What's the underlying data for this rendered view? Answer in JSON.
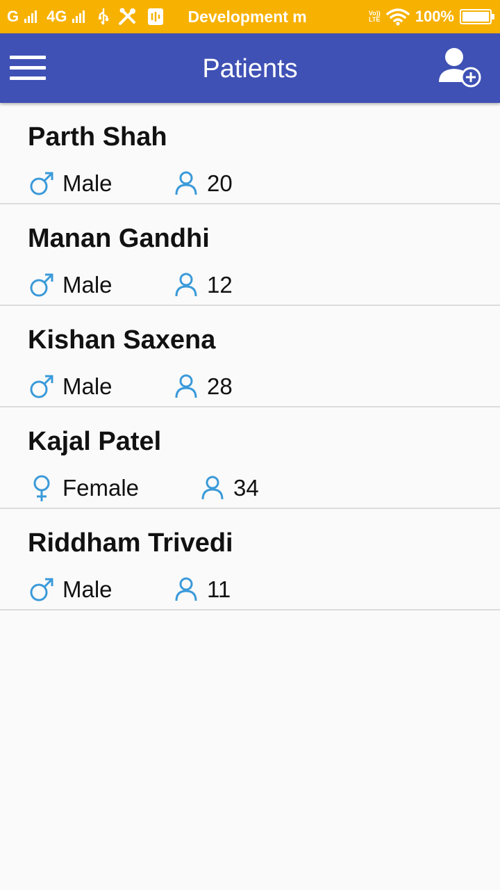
{
  "status_bar": {
    "carrier_1": "G",
    "carrier_2": "4G",
    "notification_text": "Development m",
    "volte_top": "Vo))",
    "volte_bottom": "LTE",
    "battery": "100%",
    "battery_level": 1.0
  },
  "app_bar": {
    "title": "Patients",
    "menu_icon": "hamburger-menu-icon",
    "add_icon": "add-user-icon"
  },
  "colors": {
    "status_bar": "#f7b100",
    "app_bar": "#3f51b5",
    "icon_accent": "#3a9ad9"
  },
  "patients": [
    {
      "name": "Parth Shah",
      "gender": "Male",
      "age": "20"
    },
    {
      "name": "Manan Gandhi",
      "gender": "Male",
      "age": "12"
    },
    {
      "name": "Kishan Saxena",
      "gender": "Male",
      "age": "28"
    },
    {
      "name": "Kajal Patel",
      "gender": "Female",
      "age": "34"
    },
    {
      "name": "Riddham Trivedi",
      "gender": "Male",
      "age": "11"
    }
  ]
}
